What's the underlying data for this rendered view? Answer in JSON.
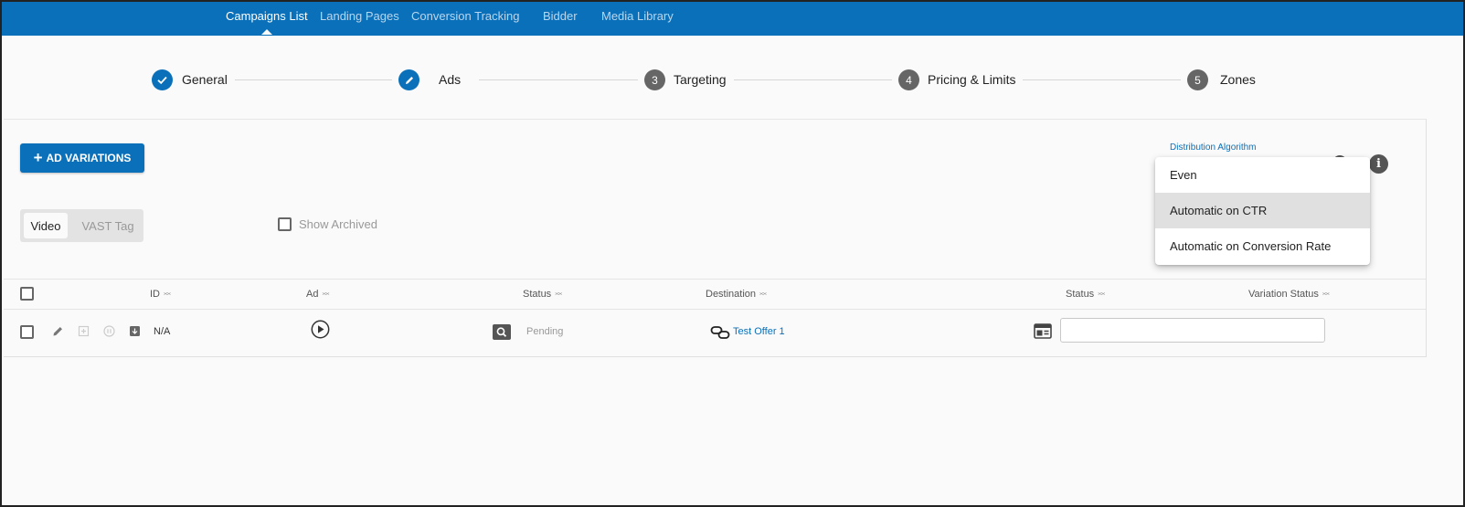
{
  "topnav": {
    "tabs": [
      {
        "label": "Campaigns List"
      },
      {
        "label": "Landing Pages"
      },
      {
        "label": "Conversion Tracking"
      },
      {
        "label": "Bidder"
      },
      {
        "label": "Media Library"
      }
    ],
    "active_tab": "Campaigns List",
    "accent_color": "#0a70b9"
  },
  "stepper": {
    "steps": [
      {
        "label": "General",
        "state": "done",
        "icon": "check-icon"
      },
      {
        "label": "Ads",
        "state": "current",
        "icon": "pencil-icon"
      },
      {
        "label": "Targeting",
        "state": "todo",
        "number": "3"
      },
      {
        "label": "Pricing & Limits",
        "state": "todo",
        "number": "4"
      },
      {
        "label": "Zones",
        "state": "todo",
        "number": "5"
      }
    ]
  },
  "toolbar": {
    "add_button_label": "AD VARIATIONS",
    "format_toggle": {
      "options": [
        "Video",
        "VAST Tag"
      ],
      "selected": "Video"
    },
    "show_archived_label": "Show Archived",
    "show_archived_checked": false,
    "distribution_label": "Distribution Algorithm"
  },
  "table": {
    "columns": [
      "ID",
      "Ad",
      "Status",
      "Destination",
      "Status",
      "Variation Status"
    ],
    "rows": [
      {
        "id": "N/A",
        "ad": "play-icon",
        "status": "Pending",
        "destination": "Test Offer 1",
        "variation_status": ""
      }
    ]
  },
  "dropdown": {
    "options": [
      "Even",
      "Automatic on CTR",
      "Automatic on Conversion Rate"
    ],
    "highlighted": "Automatic on CTR"
  }
}
